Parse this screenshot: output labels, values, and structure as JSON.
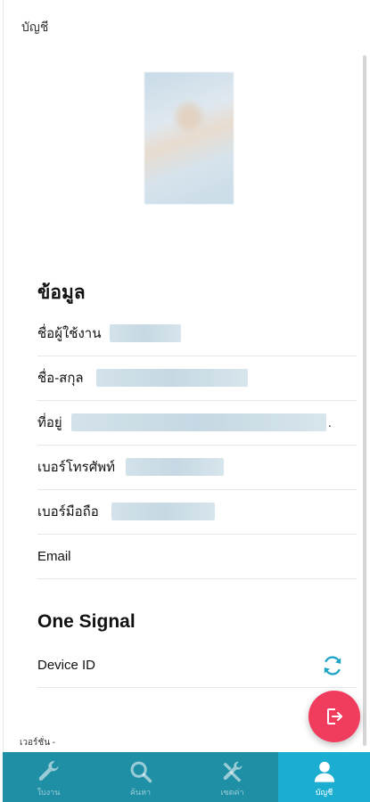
{
  "header": {
    "title": "บัญชี"
  },
  "profile": {
    "section_title": "ข้อมูล",
    "fields": [
      {
        "label": "ชื่อผู้ใช้งาน"
      },
      {
        "label": "ชื่อ-สกุล"
      },
      {
        "label": "ที่อยู่",
        "suffix": "."
      },
      {
        "label": "เบอร์โทรศัพท์"
      },
      {
        "label": "เบอร์มือถือ"
      },
      {
        "label": "Email"
      }
    ]
  },
  "onesignal": {
    "section_title": "One Signal",
    "device_id_label": "Device ID"
  },
  "version_text": "เวอร์ชั่น -",
  "nav": {
    "items": [
      {
        "label": "ใบงาน",
        "icon": "wrench-icon"
      },
      {
        "label": "ค้นหา",
        "icon": "search-icon"
      },
      {
        "label": "เซตค่า",
        "icon": "tools-icon"
      },
      {
        "label": "บัญชี",
        "icon": "user-icon",
        "active": true
      }
    ]
  },
  "colors": {
    "accent": "#1caed0",
    "nav_bg": "#1f8fa6",
    "fab": "#f03c5d",
    "sync_icon": "#1fa3c4"
  }
}
